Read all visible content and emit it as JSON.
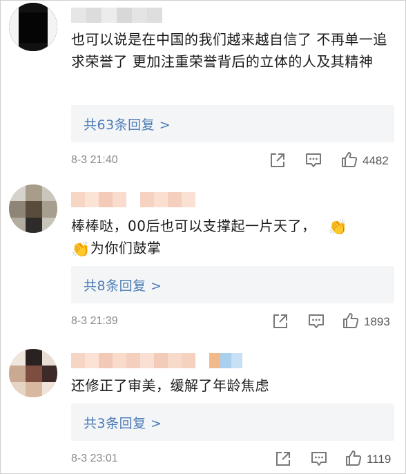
{
  "comments": [
    {
      "text": "也可以说是在中国的我们越来越自信了 不再单一追求荣誉了 更加注重荣誉背后的立体的人及其精神",
      "replies_label": "共63条回复 >",
      "time": "8-3 21:40",
      "likes": "4482"
    },
    {
      "text_part1": "棒棒哒，00后也可以支撑起一片天了，",
      "emoji": "👏",
      "text_part2": "为你们鼓掌",
      "replies_label": "共8条回复 >",
      "time": "8-3 21:39",
      "likes": "1893"
    },
    {
      "text": "还修正了审美，缓解了年龄焦虑",
      "replies_label": "共3条回复 >",
      "time": "8-3 23:01",
      "likes": "1119"
    }
  ],
  "icons": {
    "share": "share-icon",
    "comment": "comment-icon",
    "like": "thumbs-up-icon"
  },
  "colors": {
    "link": "#4a7bb5",
    "reply_box_bg": "#f4f5f7",
    "meta_text": "#8a8a8a"
  }
}
